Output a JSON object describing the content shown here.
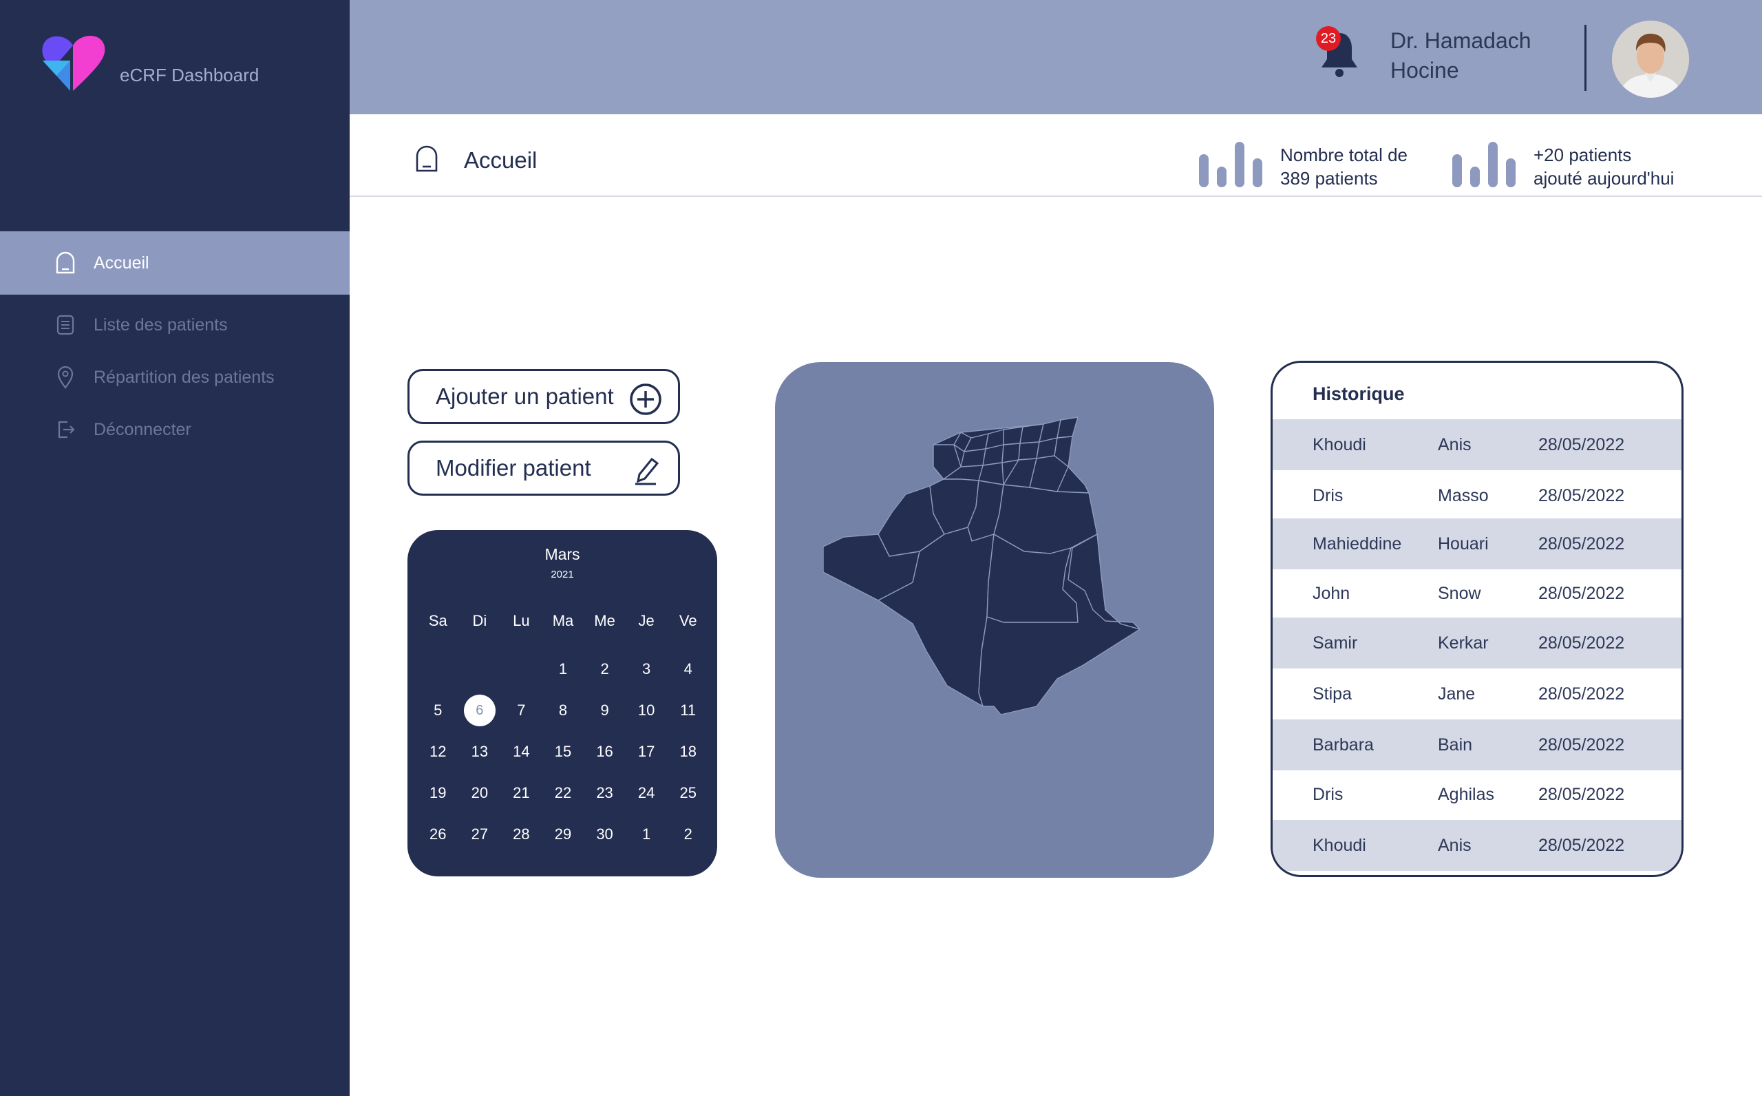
{
  "app": {
    "title": "eCRF Dashboard"
  },
  "sidebar": {
    "items": [
      {
        "label": "Accueil",
        "icon": "home-icon",
        "active": true
      },
      {
        "label": "Liste des patients",
        "icon": "list-icon",
        "active": false
      },
      {
        "label": "Répartition  des patients",
        "icon": "location-pin-icon",
        "active": false
      },
      {
        "label": "Déconnecter",
        "icon": "logout-icon",
        "active": false
      }
    ]
  },
  "header": {
    "notification_count": "23",
    "user_name": "Dr. Hamadach Hocine"
  },
  "breadcrumb": {
    "title": "Accueil"
  },
  "stats": [
    {
      "line1": "Nombre total de",
      "line2": "389 patients"
    },
    {
      "line1": "+20 patients",
      "line2": "ajouté aujourd'hui"
    }
  ],
  "actions": {
    "add_label": "Ajouter un patient",
    "edit_label": "Modifier patient"
  },
  "calendar": {
    "month": "Mars",
    "year": "2021",
    "days_of_week": [
      "Sa",
      "Di",
      "Lu",
      "Ma",
      "Me",
      "Je",
      "Ve"
    ],
    "weeks": [
      [
        "",
        "",
        "",
        "1",
        "2",
        "3",
        "4"
      ],
      [
        "5",
        "6",
        "7",
        "8",
        "9",
        "10",
        "11"
      ],
      [
        "12",
        "13",
        "14",
        "15",
        "16",
        "17",
        "18"
      ],
      [
        "19",
        "20",
        "21",
        "22",
        "23",
        "24",
        "25"
      ],
      [
        "26",
        "27",
        "28",
        "29",
        "30",
        "1",
        "2"
      ]
    ],
    "selected": "6"
  },
  "history": {
    "title": "Historique",
    "rows": [
      [
        "Khoudi",
        "Anis",
        "28/05/2022"
      ],
      [
        "Dris",
        "Masso",
        "28/05/2022"
      ],
      [
        "Mahieddine",
        "Houari",
        "28/05/2022"
      ],
      [
        "John",
        "Snow",
        "28/05/2022"
      ],
      [
        "Samir",
        "Kerkar",
        "28/05/2022"
      ],
      [
        "Stipa",
        "Jane",
        "28/05/2022"
      ],
      [
        "Barbara",
        "Bain",
        "28/05/2022"
      ],
      [
        "Dris",
        "Aghilas",
        "28/05/2022"
      ],
      [
        "Khoudi",
        "Anis",
        "28/05/2022"
      ]
    ]
  },
  "colors": {
    "sidebar": "#232e50",
    "topbar": "#94a0c1",
    "active_nav": "#8d99bf",
    "map_card": "#7382a6",
    "badge": "#e01b24"
  }
}
